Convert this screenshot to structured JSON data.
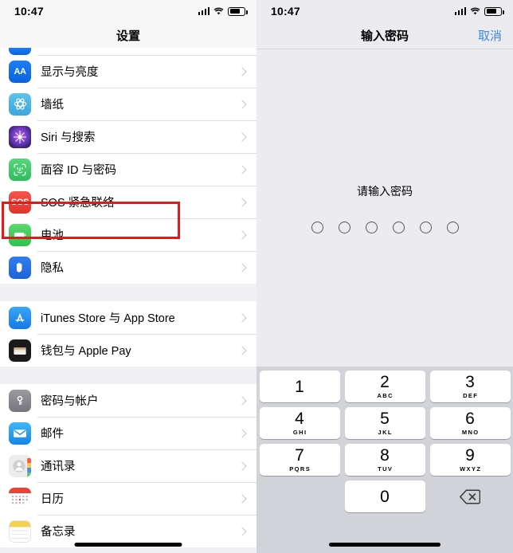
{
  "left": {
    "statusbar": {
      "time": "10:47",
      "signal_icon": "cellular-bars-icon",
      "wifi_icon": "wifi-icon",
      "battery_icon": "battery-icon"
    },
    "navbar": {
      "title": "设置"
    },
    "highlight_color": "#e01b18",
    "groups": [
      {
        "rows": [
          {
            "label": "显示与亮度",
            "icon": "display-brightness-icon",
            "glyph": "AA",
            "icon_class": "ic-aa",
            "clipped_above": true
          },
          {
            "label": "墙纸",
            "icon": "wallpaper-icon",
            "glyph": "",
            "icon_class": "ic-wall"
          },
          {
            "label": "Siri 与搜索",
            "icon": "siri-icon",
            "glyph": "",
            "icon_class": "ic-siri"
          },
          {
            "label": "面容 ID 与密码",
            "icon": "face-id-icon",
            "glyph": "",
            "icon_class": "ic-face",
            "highlighted": true
          },
          {
            "label": "SOS 紧急联络",
            "icon": "emergency-sos-icon",
            "glyph": "SOS",
            "icon_class": "ic-sos"
          },
          {
            "label": "电池",
            "icon": "battery-settings-icon",
            "glyph": "",
            "icon_class": "ic-batt"
          },
          {
            "label": "隐私",
            "icon": "privacy-hand-icon",
            "glyph": "",
            "icon_class": "ic-priv"
          }
        ]
      },
      {
        "rows": [
          {
            "label": "iTunes Store 与 App Store",
            "icon": "app-store-icon",
            "glyph": "",
            "icon_class": "ic-appstore"
          },
          {
            "label": "钱包与 Apple Pay",
            "icon": "wallet-icon",
            "glyph": "",
            "icon_class": "ic-wallet"
          }
        ]
      },
      {
        "rows": [
          {
            "label": "密码与帐户",
            "icon": "passwords-accounts-icon",
            "glyph": "",
            "icon_class": "ic-key"
          },
          {
            "label": "邮件",
            "icon": "mail-icon",
            "glyph": "",
            "icon_class": "ic-mail"
          },
          {
            "label": "通讯录",
            "icon": "contacts-icon",
            "glyph": "",
            "icon_class": "ic-contacts"
          },
          {
            "label": "日历",
            "icon": "calendar-icon",
            "glyph": "",
            "icon_class": "ic-cal"
          },
          {
            "label": "备忘录",
            "icon": "notes-icon",
            "glyph": "",
            "icon_class": "ic-notes"
          }
        ]
      }
    ],
    "chevron_icon": "chevron-right-icon"
  },
  "right": {
    "statusbar": {
      "time": "10:47",
      "signal_icon": "cellular-bars-icon",
      "wifi_icon": "wifi-icon",
      "battery_icon": "battery-icon"
    },
    "navbar": {
      "title": "输入密码",
      "cancel_label": "取消",
      "cancel_color": "#3d87e8"
    },
    "prompt": "请输入密码",
    "passcode": {
      "length": 6,
      "filled": 0
    },
    "keypad": {
      "keys": [
        {
          "num": "1",
          "sub": ""
        },
        {
          "num": "2",
          "sub": "ABC"
        },
        {
          "num": "3",
          "sub": "DEF"
        },
        {
          "num": "4",
          "sub": "GHI"
        },
        {
          "num": "5",
          "sub": "JKL"
        },
        {
          "num": "6",
          "sub": "MNO"
        },
        {
          "num": "7",
          "sub": "PQRS"
        },
        {
          "num": "8",
          "sub": "TUV"
        },
        {
          "num": "9",
          "sub": "WXYZ"
        },
        {
          "num": "0",
          "sub": ""
        }
      ],
      "delete_icon": "backspace-delete-icon"
    }
  }
}
